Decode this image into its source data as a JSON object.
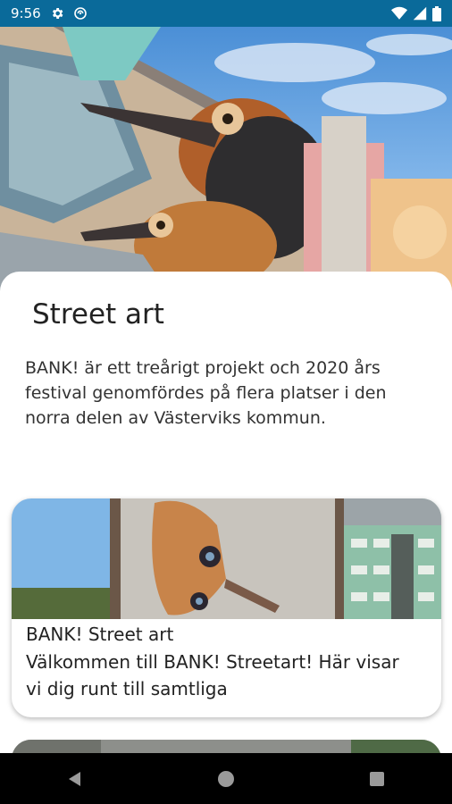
{
  "status_bar": {
    "time": "9:56",
    "icons": [
      "gear-icon",
      "vpn-key-icon",
      "wifi-icon",
      "signal-icon",
      "battery-icon"
    ]
  },
  "hero": {
    "image": "street-art-mural-with-birds"
  },
  "page": {
    "title": "Street art",
    "description": "BANK! är ett treårigt projekt och 2020 års festival genomfördes på flera platser i den norra delen av Västerviks kommun."
  },
  "cards": [
    {
      "title": "BANK! Street art",
      "description": "Välkommen till BANK! Streetart! Här visar vi dig runt till samtliga",
      "image": "moth-mural-and-buildings"
    },
    {
      "image": "street-photo"
    }
  ],
  "nav": {
    "buttons": [
      "back-icon",
      "home-icon",
      "recents-icon"
    ]
  },
  "colors": {
    "status_bar": "#0a6a9a",
    "nav_bar": "#000000"
  }
}
